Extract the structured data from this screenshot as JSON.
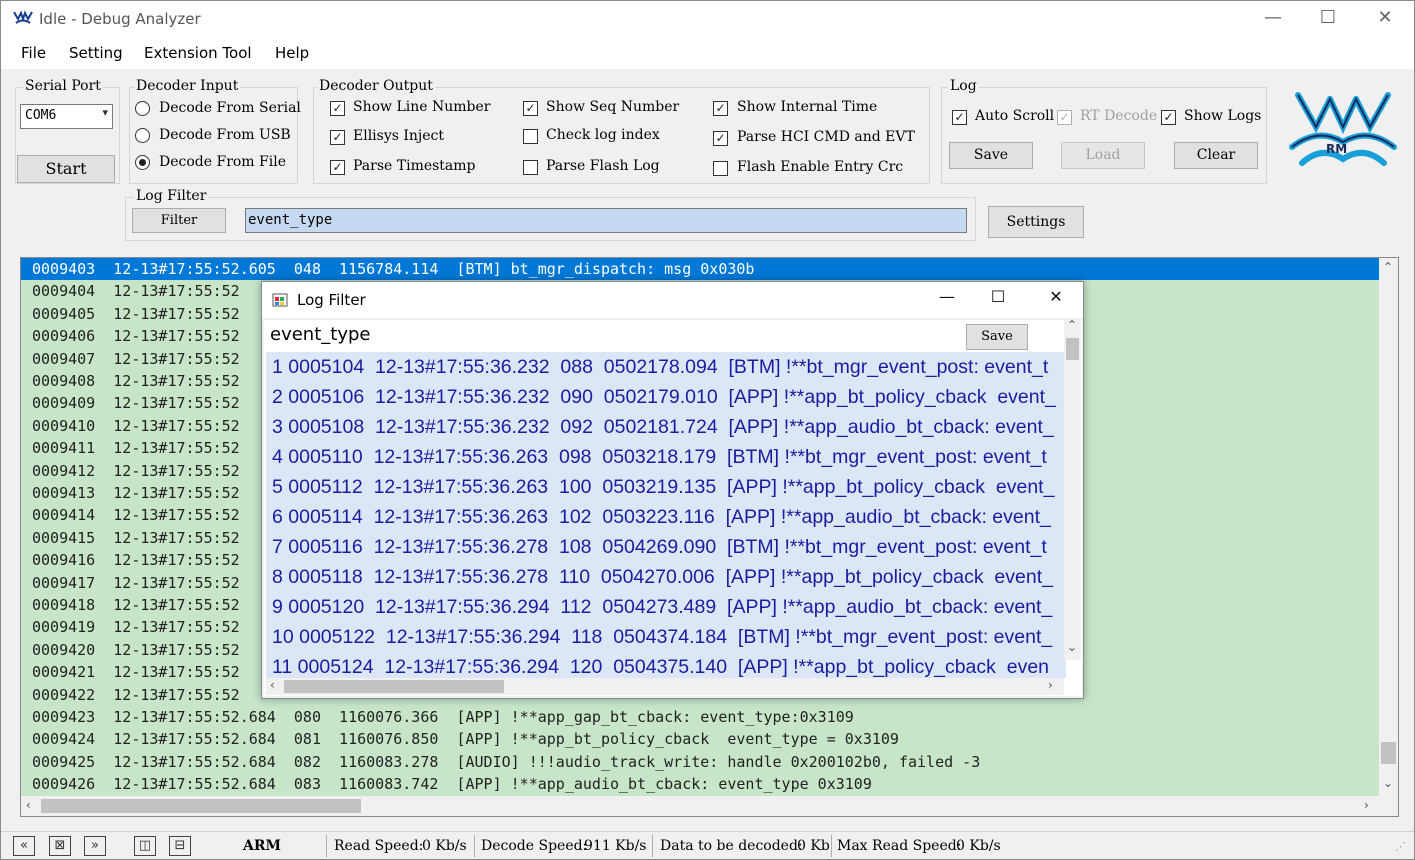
{
  "window": {
    "title": "Idle - Debug Analyzer",
    "minimize_glyph": "—",
    "maximize_glyph": "☐",
    "close_glyph": "✕"
  },
  "menu": [
    "File",
    "Setting",
    "Extension Tool",
    "Help"
  ],
  "serial_port": {
    "label": "Serial Port",
    "value": "COM6",
    "start_label": "Start"
  },
  "decoder_input": {
    "label": "Decoder Input",
    "options": [
      "Decode From Serial",
      "Decode From USB",
      "Decode From File"
    ],
    "selected": "Decode From File"
  },
  "decoder_output": {
    "label": "Decoder Output",
    "options": [
      {
        "label": "Show Line Number",
        "checked": true
      },
      {
        "label": "Ellisys Inject",
        "checked": true
      },
      {
        "label": "Parse Timestamp",
        "checked": true
      },
      {
        "label": "Show Seq Number",
        "checked": true
      },
      {
        "label": "Check log index",
        "checked": false
      },
      {
        "label": "Parse Flash Log",
        "checked": false
      },
      {
        "label": "Show Internal Time",
        "checked": true
      },
      {
        "label": "Parse HCI CMD and EVT",
        "checked": true
      },
      {
        "label": "Flash Enable Entry Crc",
        "checked": false
      }
    ]
  },
  "log_group": {
    "label": "Log",
    "auto_scroll": "Auto Scroll",
    "rt_decode": "RT Decode",
    "show_logs": "Show Logs",
    "save": "Save",
    "load": "Load",
    "clear": "Clear"
  },
  "log_filter": {
    "label": "Log Filter",
    "filter_button": "Filter",
    "value": "event_type",
    "settings_button": "Settings"
  },
  "log_rows": [
    "0009403  12-13#17:55:52.605  048  1156784.114  [BTM] bt_mgr_dispatch: msg 0x030b",
    "0009404  12-13#17:55:52",
    "0009405  12-13#17:55:52",
    "0009406  12-13#17:55:52",
    "0009407  12-13#17:55:52",
    "0009408  12-13#17:55:52",
    "0009409  12-13#17:55:52",
    "0009410  12-13#17:55:52",
    "0009411  12-13#17:55:52",
    "0009412  12-13#17:55:52",
    "0009413  12-13#17:55:52",
    "0009414  12-13#17:55:52",
    "0009415  12-13#17:55:52",
    "0009416  12-13#17:55:52",
    "0009417  12-13#17:55:52",
    "0009418  12-13#17:55:52",
    "0009419  12-13#17:55:52",
    "0009420  12-13#17:55:52",
    "0009421  12-13#17:55:52",
    "0009422  12-13#17:55:52",
    "0009423  12-13#17:55:52.684  080  1160076.366  [APP] !**app_gap_bt_cback: event_type:0x3109",
    "0009424  12-13#17:55:52.684  081  1160076.850  [APP] !**app_bt_policy_cback  event_type = 0x3109",
    "0009425  12-13#17:55:52.684  082  1160083.278  [AUDIO] !!!audio_track_write: handle 0x200102b0, failed -3",
    "0009426  12-13#17:55:52.684  083  1160083.742  [APP] !**app_audio_bt_cback: event_type 0x3109"
  ],
  "dialog": {
    "title": "Log Filter",
    "query": "event_type",
    "save": "Save",
    "rows": [
      "1 0005104  12-13#17:55:36.232  088  0502178.094  [BTM] !**bt_mgr_event_post: event_t",
      "2 0005106  12-13#17:55:36.232  090  0502179.010  [APP] !**app_bt_policy_cback  event_",
      "3 0005108  12-13#17:55:36.232  092  0502181.724  [APP] !**app_audio_bt_cback: event_",
      "4 0005110  12-13#17:55:36.263  098  0503218.179  [BTM] !**bt_mgr_event_post: event_t",
      "5 0005112  12-13#17:55:36.263  100  0503219.135  [APP] !**app_bt_policy_cback  event_",
      "6 0005114  12-13#17:55:36.263  102  0503223.116  [APP] !**app_audio_bt_cback: event_",
      "7 0005116  12-13#17:55:36.278  108  0504269.090  [BTM] !**bt_mgr_event_post: event_t",
      "8 0005118  12-13#17:55:36.278  110  0504270.006  [APP] !**app_bt_policy_cback  event_",
      "9 0005120  12-13#17:55:36.294  112  0504273.489  [APP] !**app_audio_bt_cback: event_",
      "10 0005122  12-13#17:55:36.294  118  0504374.184  [BTM] !**bt_mgr_event_post: event_",
      "11 0005124  12-13#17:55:36.294  120  0504375.140  [APP] !**app_bt_policy_cback  even"
    ]
  },
  "statusbar": {
    "arch": "ARM",
    "read_speed_label": "Read Speed:",
    "read_speed": "0 Kb/s",
    "decode_speed_label": "Decode Speed:",
    "decode_speed": "911 Kb/s",
    "data_label": "Data to be decoded:",
    "data_value": "0 Kb",
    "max_read_label": "Max Read Speed:",
    "max_read_value": "0 Kb/s"
  },
  "colors": {
    "log_bg": "#c6e5c9",
    "selection": "#0078d7",
    "dialog_list_bg": "#dbe7f6",
    "dialog_text": "#1c1ca0",
    "logo": "#1aa0d8"
  }
}
